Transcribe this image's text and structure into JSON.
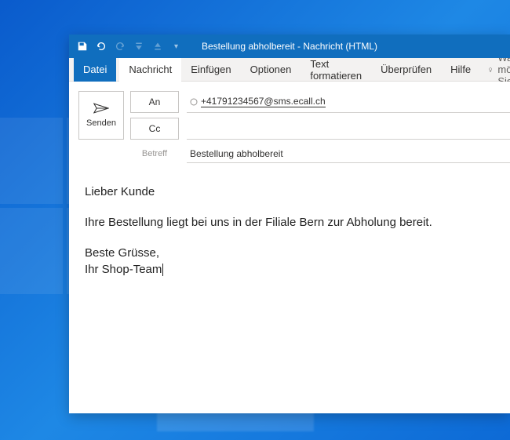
{
  "window": {
    "title": "Bestellung abholbereit  -  Nachricht (HTML)"
  },
  "ribbon": {
    "file": "Datei",
    "tabs": [
      "Nachricht",
      "Einfügen",
      "Optionen",
      "Text formatieren",
      "Überprüfen",
      "Hilfe"
    ],
    "tell_me": "Was möchten Sie tun?"
  },
  "compose": {
    "send": "Senden",
    "to_label": "An",
    "cc_label": "Cc",
    "subject_label": "Betreff",
    "to_value": "+41791234567@sms.ecall.ch",
    "cc_value": "",
    "subject_value": "Bestellung abholbereit"
  },
  "body": {
    "greeting": "Lieber Kunde",
    "paragraph1": "Ihre Bestellung liegt bei uns in der Filiale Bern zur Abholung bereit.",
    "closing_line1": "Beste Grüsse,",
    "closing_line2": "Ihr Shop-Team"
  }
}
